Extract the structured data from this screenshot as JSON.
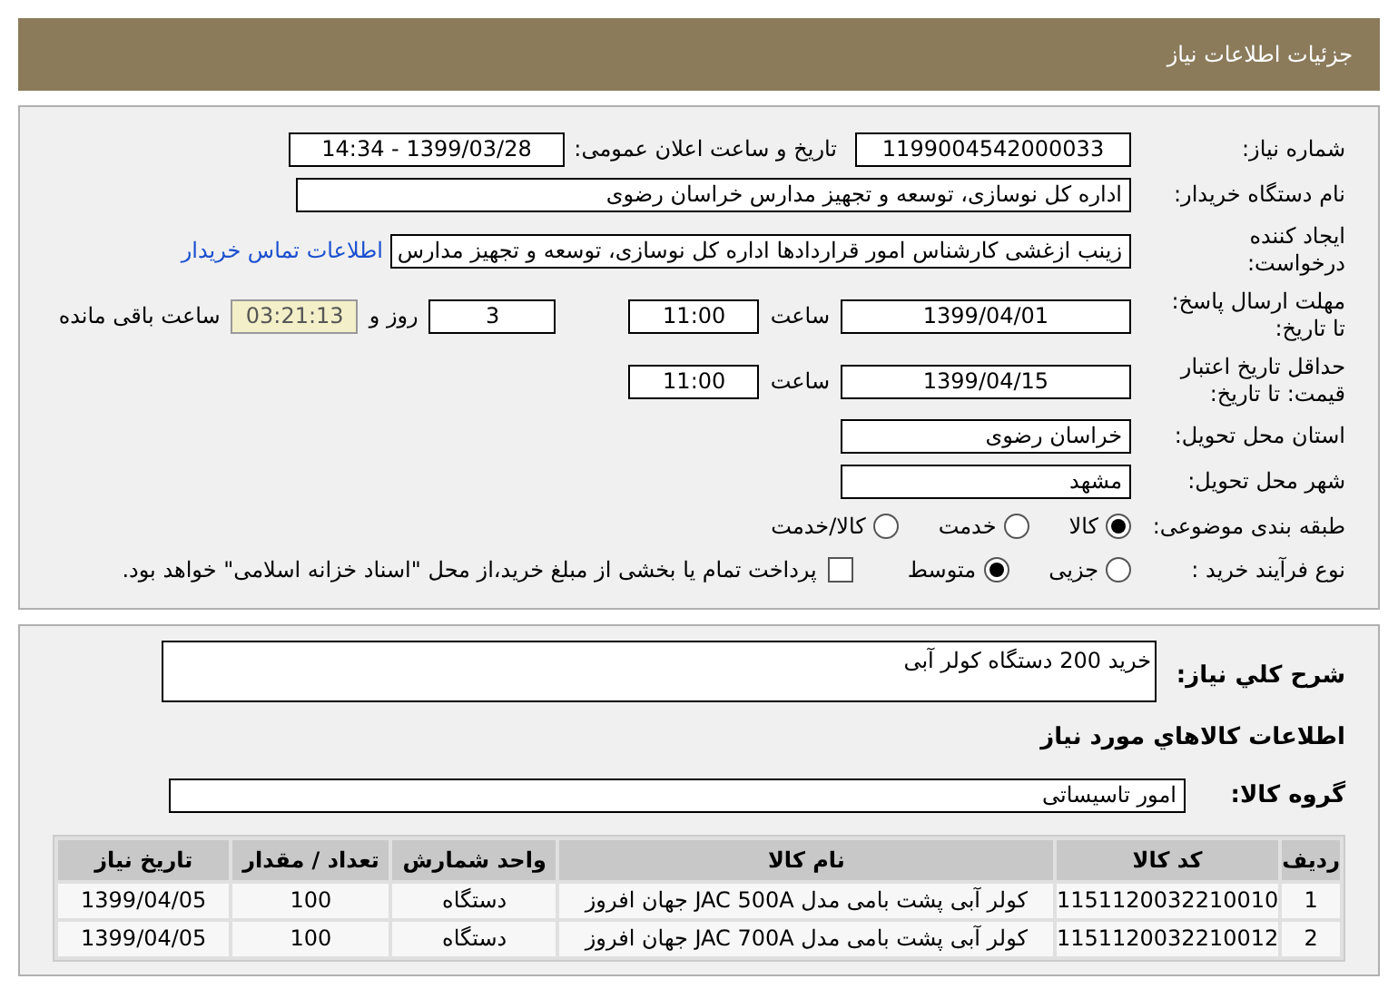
{
  "header": {
    "title": "جزئیات اطلاعات نیاز"
  },
  "need_number": {
    "label": "شماره نیاز:",
    "value": "1199004542000033"
  },
  "announce": {
    "label": "تاریخ و ساعت اعلان عمومی:",
    "value": "1399/03/28 - 14:34"
  },
  "buyer": {
    "label": "نام دستگاه خریدار:",
    "value": "اداره کل نوسازی، توسعه و تجهیز مدارس خراسان رضوی"
  },
  "requester": {
    "label": "ایجاد کننده درخواست:",
    "value": "زینب ازغشی کارشناس امور قراردادها اداره کل نوسازی، توسعه و تجهیز مدارس",
    "link": "اطلاعات تماس خریدار"
  },
  "reply_deadline": {
    "label": "مهلت ارسال پاسخ: تا تاریخ:",
    "date": "1399/04/01",
    "time_label": "ساعت",
    "time": "11:00",
    "days": "3",
    "days_label": "روز و",
    "remaining": "03:21:13",
    "remaining_label": "ساعت باقی مانده"
  },
  "price_validity": {
    "label": "حداقل تاریخ اعتبار قیمت: تا تاریخ:",
    "date": "1399/04/15",
    "time_label": "ساعت",
    "time": "11:00"
  },
  "province": {
    "label": "استان محل تحویل:",
    "value": "خراسان رضوی"
  },
  "city": {
    "label": "شهر محل تحویل:",
    "value": "مشهد"
  },
  "category": {
    "label": "طبقه بندی موضوعی:",
    "options": [
      {
        "label": "کالا",
        "selected": true
      },
      {
        "label": "خدمت",
        "selected": false
      },
      {
        "label": "کالا/خدمت",
        "selected": false
      }
    ]
  },
  "process": {
    "label": "نوع فرآیند خرید :",
    "options": [
      {
        "label": "جزیی",
        "selected": false
      },
      {
        "label": "متوسط",
        "selected": true
      }
    ],
    "treasury": {
      "checked": false,
      "text": "پرداخت تمام یا بخشی از مبلغ خرید،از محل \"اسناد خزانه اسلامی\" خواهد بود."
    }
  },
  "description": {
    "label": "شرح كلي نیاز:",
    "value": "خرید 200 دستگاه کولر آبی"
  },
  "goods_heading": "اطلاعات كالاهاي مورد نياز",
  "goods_group": {
    "label": "گروه کالا:",
    "value": "امور تاسیساتی"
  },
  "table": {
    "columns": [
      "ردیف",
      "کد کالا",
      "نام کالا",
      "واحد شمارش",
      "تعداد / مقدار",
      "تاریخ نیاز"
    ],
    "rows": [
      [
        "1",
        "1151120032210010",
        "کولر آبی پشت بامی مدل JAC 500A جهان افروز",
        "دستگاه",
        "100",
        "1399/04/05"
      ],
      [
        "2",
        "1151120032210012",
        "کولر آبی پشت بامی مدل JAC 700A جهان افروز",
        "دستگاه",
        "100",
        "1399/04/05"
      ]
    ]
  }
}
